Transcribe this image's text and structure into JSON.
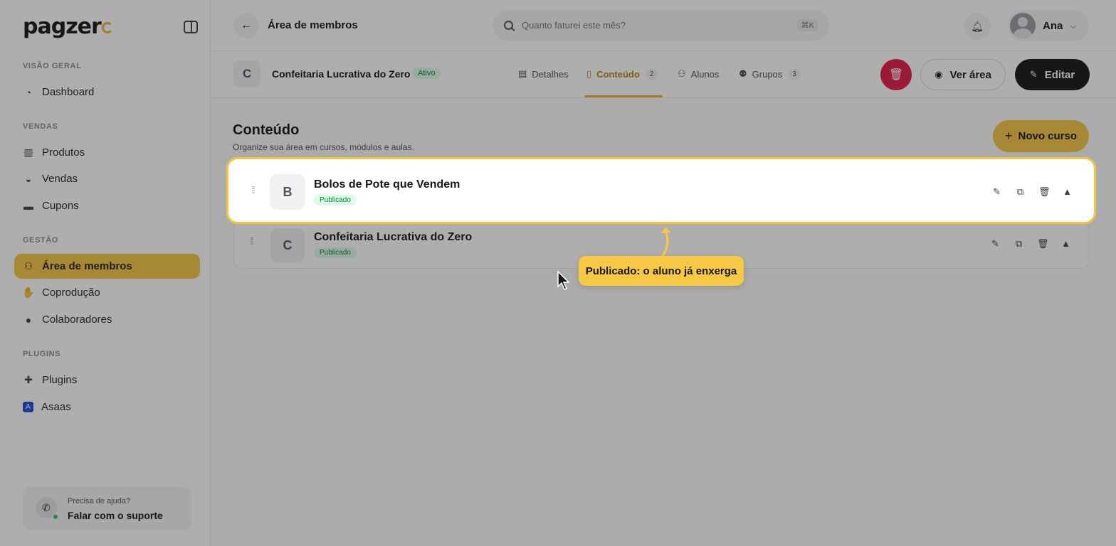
{
  "brand": {
    "logo_text": "pagzer",
    "accent": "#f5c542"
  },
  "sidebar": {
    "sections": [
      {
        "label": "VISÃO GERAL"
      },
      {
        "label": "VENDAS"
      },
      {
        "label": "GESTÃO"
      },
      {
        "label": "PLUGINS"
      }
    ],
    "items": [
      {
        "label": "Dashboard",
        "icon": "dashboard-icon"
      },
      {
        "label": "Produtos",
        "icon": "products-icon"
      },
      {
        "label": "Vendas",
        "icon": "sales-icon"
      },
      {
        "label": "Cupons",
        "icon": "coupon-icon"
      },
      {
        "label": "Área de membros",
        "icon": "members-icon",
        "active": true
      },
      {
        "label": "Coprodução",
        "icon": "handshake-icon"
      },
      {
        "label": "Colaboradores",
        "icon": "user-icon"
      },
      {
        "label": "Plugins",
        "icon": "puzzle-icon"
      },
      {
        "label": "Asaas",
        "icon": "asaas-icon"
      }
    ],
    "help": {
      "small": "Precisa de ajuda?",
      "big": "Falar com o suporte"
    }
  },
  "topbar": {
    "title": "Área de membros",
    "search_placeholder": "Quanto faturei este mês?",
    "shortcut": "⌘K",
    "user_name": "Ana"
  },
  "course_header": {
    "avatar_letter": "C",
    "name": "Confeitaria Lucrativa do Zero",
    "status": "Ativo",
    "tabs": [
      {
        "label": "Detalhes",
        "count": ""
      },
      {
        "label": "Conteúdo",
        "count": "2",
        "active": true
      },
      {
        "label": "Alunos",
        "count": ""
      },
      {
        "label": "Grupos",
        "count": "3"
      }
    ],
    "view_label": "Ver área",
    "edit_label": "Editar"
  },
  "content": {
    "title": "Conteúdo",
    "subtitle": "Organize sua área em cursos, módulos e aulas.",
    "new_course_label": "Novo curso",
    "courses": [
      {
        "letter": "B",
        "title": "Bolos de Pote que Vendem",
        "status": "Publicado"
      },
      {
        "letter": "C",
        "title": "Confeitaria Lucrativa do Zero",
        "status": "Publicado"
      }
    ]
  },
  "tour": {
    "tooltip": "Publicado: o aluno já enxerga"
  }
}
